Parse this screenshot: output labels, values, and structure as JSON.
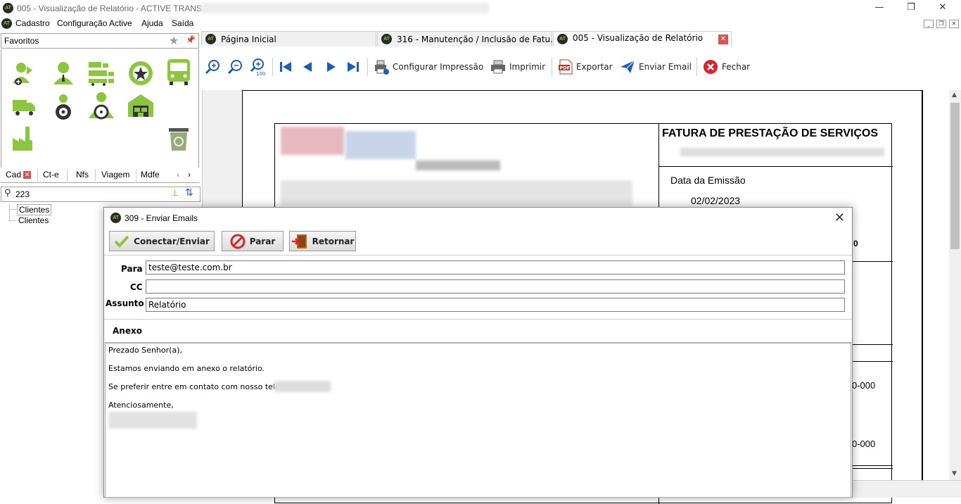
{
  "window": {
    "title": "005 - Visualização de Relatório - ACTIVE TRANS -",
    "logo_text": "AT"
  },
  "menu": [
    "Cadastro",
    "Configuração Active",
    "Ajuda",
    "Saída"
  ],
  "favorites": {
    "label": "Favoritos"
  },
  "left_tabs": [
    "Cad",
    "Ct-e",
    "Nfs",
    "Viagem",
    "Mdfe"
  ],
  "search": {
    "value": "223"
  },
  "tree": [
    "Clientes",
    "Clientes"
  ],
  "doc_tabs": [
    {
      "label": "Página Inicial"
    },
    {
      "label": "316 - Manutenção / Inclusão de Fatu..."
    },
    {
      "label": "005 - Visualização de Relatório"
    }
  ],
  "toolbar": {
    "config_print": "Configurar Impressão",
    "print": "Imprimir",
    "export": "Exportar",
    "send_email": "Enviar Email",
    "close": "Fechar"
  },
  "report": {
    "title": "FATURA DE PRESTAÇÃO DE SERVIÇOS",
    "emission_label": "Data da Emissão",
    "emission_date": "02/02/2023",
    "partial_1": "0",
    "partial_2": "0-000",
    "partial_3": "0-000"
  },
  "dialog": {
    "title": "309 - Enviar Emails",
    "btn_connect": "Conectar/Enviar",
    "btn_stop": "Parar",
    "btn_return": "Retornar",
    "label_to": "Para",
    "value_to": "teste@teste.com.br",
    "label_cc": "CC",
    "value_cc": "",
    "label_subject": "Assunto",
    "value_subject": "Relatório",
    "label_attachment": "Anexo",
    "body": {
      "greeting": "Prezado Senhor(a),",
      "line1": "Estamos enviando em anexo o relatório.",
      "line2": "Se preferir entre em contato com nosso telefone",
      "closing": "Atenciosamente,"
    }
  },
  "colors": {
    "accent_green": "#8cc63f",
    "close_red": "#d9534f",
    "nav_blue": "#1a5fb4"
  }
}
